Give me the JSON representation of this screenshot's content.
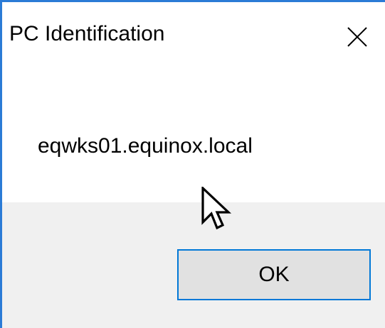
{
  "dialog": {
    "title": "PC Identification",
    "close_icon": "close-icon",
    "message": "eqwks01.equinox.local",
    "ok_label": "OK"
  },
  "colors": {
    "window_border": "#2b7bd6",
    "button_border": "#0078d7",
    "button_face": "#e1e1e1",
    "footer_bg": "#f0f0f0"
  },
  "pointer_icon": "mouse-pointer-icon"
}
